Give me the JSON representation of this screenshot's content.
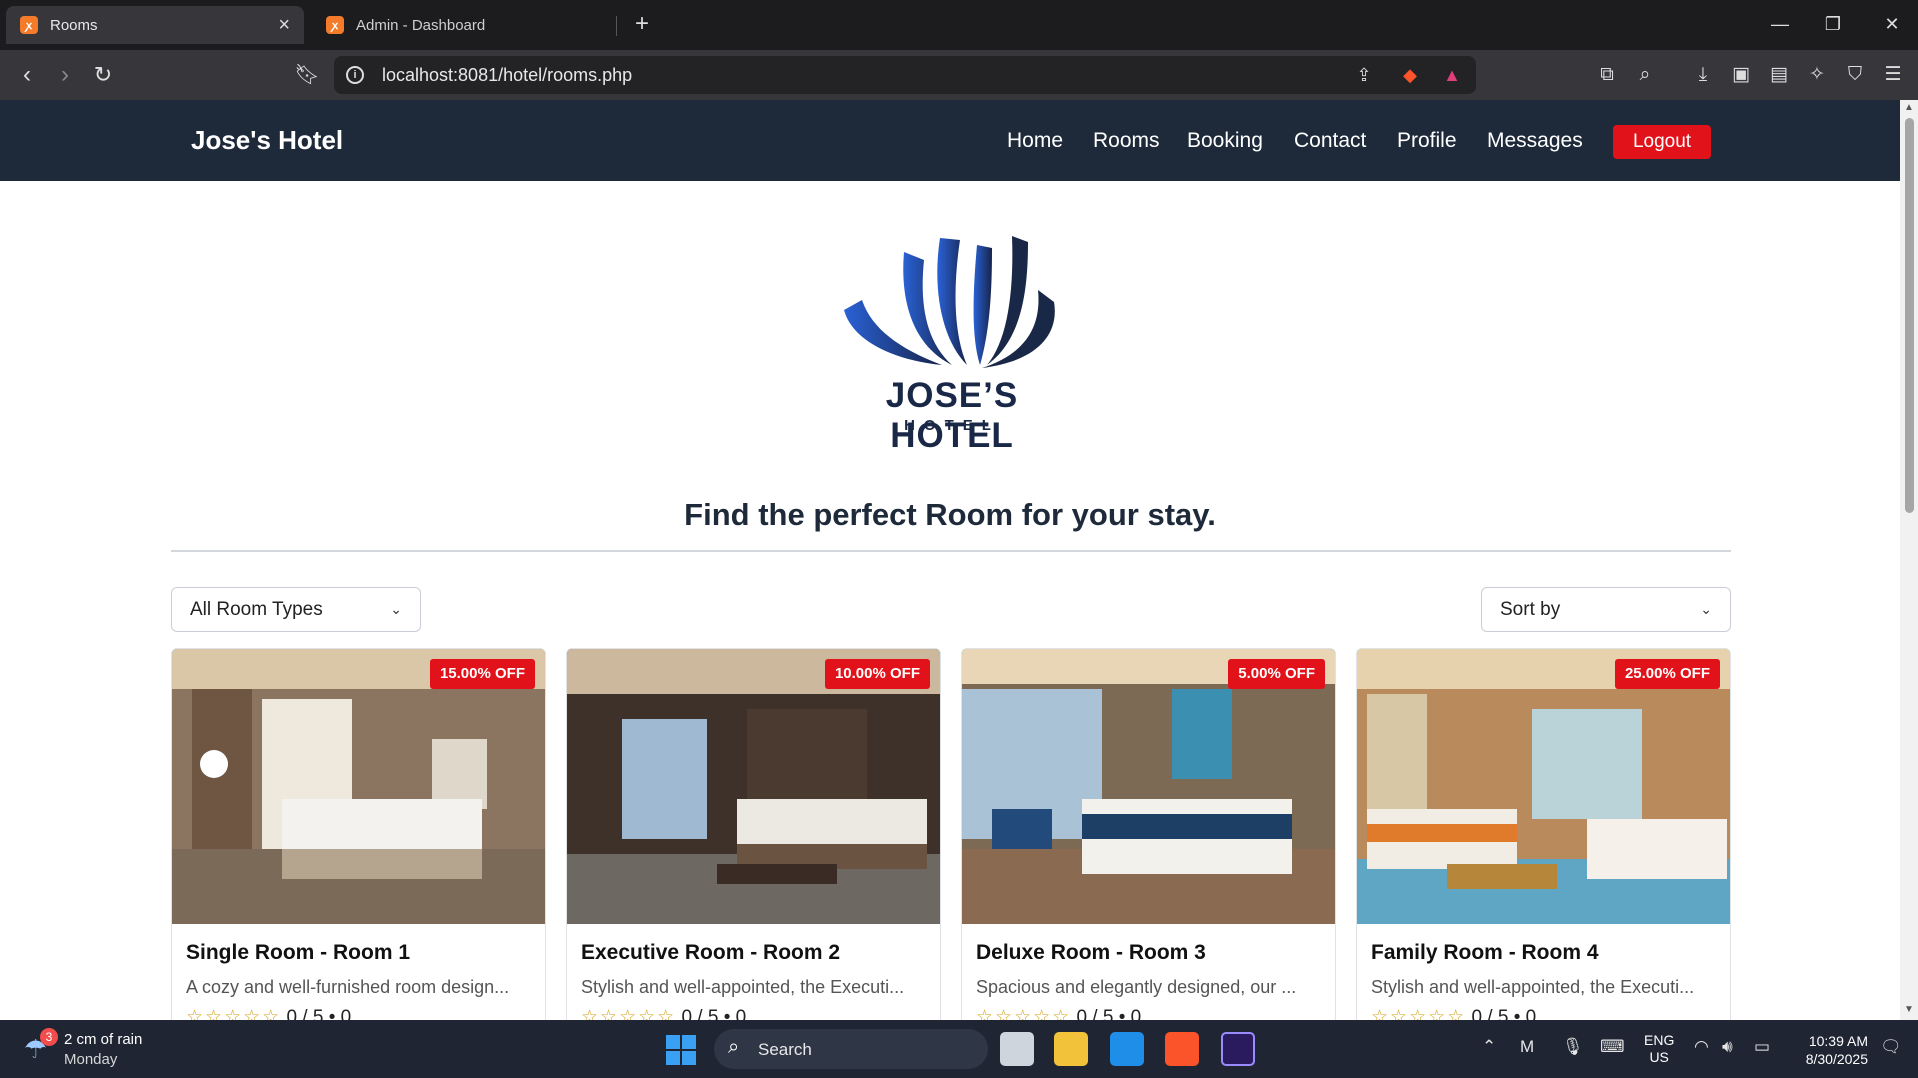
{
  "browser": {
    "tabs": [
      {
        "title": "Rooms",
        "active": true
      },
      {
        "title": "Admin - Dashboard",
        "active": false
      }
    ],
    "url": "localhost:8081/hotel/rooms.php"
  },
  "site": {
    "brand": "Jose's Hotel",
    "nav": [
      "Home",
      "Rooms",
      "Booking",
      "Contact",
      "Profile",
      "Messages"
    ],
    "logout_label": "Logout"
  },
  "logo": {
    "name": "JOSE’S HOTEL",
    "sub": "HOTEL"
  },
  "headline": "Find the perfect Room for your stay.",
  "filters": {
    "room_type": "All Room Types",
    "sort": "Sort by"
  },
  "rooms": [
    {
      "discount": "15.00% OFF",
      "title": "Single Room - Room 1",
      "desc": "A cozy and well-furnished room design...",
      "rating": "0 / 5",
      "reviews": "0"
    },
    {
      "discount": "10.00% OFF",
      "title": "Executive Room - Room 2",
      "desc": "Stylish and well-appointed, the Executi...",
      "rating": "0 / 5",
      "reviews": "0"
    },
    {
      "discount": "5.00% OFF",
      "title": "Deluxe Room - Room 3",
      "desc": "Spacious and elegantly designed, our ...",
      "rating": "0 / 5",
      "reviews": "0"
    },
    {
      "discount": "25.00% OFF",
      "title": "Family Room - Room 4",
      "desc": "Stylish and well-appointed, the Executi...",
      "rating": "0 / 5",
      "reviews": "0"
    }
  ],
  "taskbar": {
    "weather_badge": "3",
    "weather_line1": "2 cm of rain",
    "weather_line2": "Monday",
    "search_label": "Search",
    "lang_line1": "ENG",
    "lang_line2": "US",
    "time": "10:39 AM",
    "date": "8/30/2025"
  },
  "colors": {
    "nav_bg": "#1e2a3a",
    "accent_red": "#e1121a",
    "logo_navy": "#1a2848",
    "logo_blue": "#2456c9"
  }
}
